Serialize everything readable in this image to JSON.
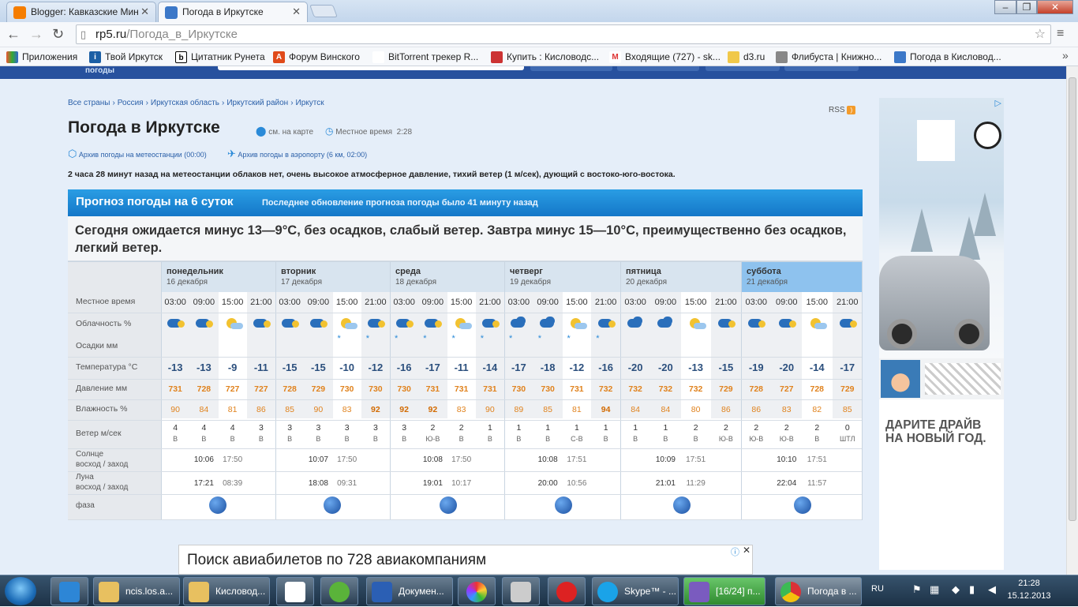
{
  "browser": {
    "tabs": [
      {
        "label": "Blogger: Кавказские Мин"
      },
      {
        "label": "Погода в Иркутске"
      }
    ],
    "url_host": "rp5.ru",
    "url_path": "/Погода_в_Иркутске",
    "bookmarks": [
      "Приложения",
      "Твой Иркутск",
      "Цитатник Рунета",
      "Форум Винского",
      "BitTorrent трекер R...",
      "Купить : Кисловодс...",
      "Входящие (727) - sk...",
      "d3.ru",
      "Флибуста | Книжно...",
      "Погода в Кисловод..."
    ]
  },
  "site": {
    "logo_text": "погоды"
  },
  "breadcrumb": [
    "Все страны",
    "Россия",
    "Иркутская область",
    "Иркутский район",
    "Иркутск"
  ],
  "page": {
    "title": "Погода в Иркутске",
    "map_link": "см. на карте",
    "local_time_label": "Местное время",
    "local_time": "2:28",
    "archive_station": "Архив погоды на метеостанции (00:00)",
    "archive_airport": "Архив погоды в аэропорту (6 км, 02:00)",
    "rss": "RSS",
    "observation": "2 часа 28 минут назад на метеостанции облаков нет, очень высокое атмосферное давление, тихий ветер (1 м/сек), дующий с востоко-юго-востока."
  },
  "forecast": {
    "header_title": "Прогноз погоды на 6 суток",
    "header_update": "Последнее обновление прогноза погоды было 41 минуту назад",
    "summary": "Сегодня ожидается минус 13—9°С, без осадков, слабый ветер. Завтра минус 15—10°С, преимущественно без осадков, легкий ветер.",
    "row_labels": {
      "time": "Местное время",
      "cloud": "Облачность %",
      "precip": "Осадки мм",
      "temp": "Температура °С",
      "pressure": "Давление мм",
      "humidity": "Влажность %",
      "wind": "Ветер м/сек",
      "sun": "Солнце",
      "sun_sub": "восход / заход",
      "moon": "Луна",
      "moon_sub": "восход / заход",
      "phase": "фаза"
    },
    "days": [
      {
        "name": "понедельник",
        "date": "16 декабря",
        "sunrise": "10:06",
        "sunset": "17:50",
        "moonrise": "17:21",
        "moonset": "08:39",
        "slots": [
          {
            "time": "03:00",
            "icon": "cloud-moon",
            "precip": "",
            "temp": "-13",
            "pres": "731",
            "hum": "90",
            "wind": "4",
            "dir": "В"
          },
          {
            "time": "09:00",
            "icon": "cloud-moon",
            "precip": "",
            "temp": "-13",
            "pres": "728",
            "hum": "84",
            "wind": "4",
            "dir": "В"
          },
          {
            "time": "15:00",
            "icon": "sun-cloud",
            "precip": "",
            "temp": "-9",
            "pres": "727",
            "hum": "81",
            "wind": "4",
            "dir": "В"
          },
          {
            "time": "21:00",
            "icon": "cloud-moon",
            "precip": "",
            "temp": "-11",
            "pres": "727",
            "hum": "86",
            "wind": "3",
            "dir": "В"
          }
        ]
      },
      {
        "name": "вторник",
        "date": "17 декабря",
        "sunrise": "10:07",
        "sunset": "17:50",
        "moonrise": "18:08",
        "moonset": "09:31",
        "slots": [
          {
            "time": "03:00",
            "icon": "cloud-moon",
            "precip": "",
            "temp": "-15",
            "pres": "728",
            "hum": "85",
            "wind": "3",
            "dir": "В"
          },
          {
            "time": "09:00",
            "icon": "cloud-moon",
            "precip": "",
            "temp": "-15",
            "pres": "729",
            "hum": "90",
            "wind": "3",
            "dir": "В"
          },
          {
            "time": "15:00",
            "icon": "sun-cloud",
            "precip": "*",
            "temp": "-10",
            "pres": "730",
            "hum": "83",
            "wind": "3",
            "dir": "В"
          },
          {
            "time": "21:00",
            "icon": "cloud-moon",
            "precip": "*",
            "temp": "-12",
            "pres": "730",
            "hum": "92",
            "wind": "3",
            "dir": "В"
          }
        ]
      },
      {
        "name": "среда",
        "date": "18 декабря",
        "sunrise": "10:08",
        "sunset": "17:50",
        "moonrise": "19:01",
        "moonset": "10:17",
        "slots": [
          {
            "time": "03:00",
            "icon": "cloud-moon",
            "precip": "*",
            "temp": "-16",
            "pres": "730",
            "hum": "92",
            "wind": "3",
            "dir": "В"
          },
          {
            "time": "09:00",
            "icon": "cloud-moon",
            "precip": "*",
            "temp": "-17",
            "pres": "731",
            "hum": "92",
            "wind": "2",
            "dir": "Ю-В"
          },
          {
            "time": "15:00",
            "icon": "sun-cloud",
            "precip": "*",
            "temp": "-11",
            "pres": "731",
            "hum": "83",
            "wind": "2",
            "dir": "В"
          },
          {
            "time": "21:00",
            "icon": "cloud-moon",
            "precip": "*",
            "temp": "-14",
            "pres": "731",
            "hum": "90",
            "wind": "1",
            "dir": "В"
          }
        ]
      },
      {
        "name": "четверг",
        "date": "19 декабря",
        "sunrise": "10:08",
        "sunset": "17:51",
        "moonrise": "20:00",
        "moonset": "10:56",
        "slots": [
          {
            "time": "03:00",
            "icon": "cloud",
            "precip": "*",
            "temp": "-17",
            "pres": "730",
            "hum": "89",
            "wind": "1",
            "dir": "В"
          },
          {
            "time": "09:00",
            "icon": "cloud",
            "precip": "*",
            "temp": "-18",
            "pres": "730",
            "hum": "85",
            "wind": "1",
            "dir": "В"
          },
          {
            "time": "15:00",
            "icon": "sun-cloud",
            "precip": "*",
            "temp": "-12",
            "pres": "731",
            "hum": "81",
            "wind": "1",
            "dir": "С-В"
          },
          {
            "time": "21:00",
            "icon": "cloud-moon",
            "precip": "*",
            "temp": "-16",
            "pres": "732",
            "hum": "94",
            "wind": "1",
            "dir": "В"
          }
        ]
      },
      {
        "name": "пятница",
        "date": "20 декабря",
        "sunrise": "10:09",
        "sunset": "17:51",
        "moonrise": "21:01",
        "moonset": "11:29",
        "slots": [
          {
            "time": "03:00",
            "icon": "cloud",
            "precip": "",
            "temp": "-20",
            "pres": "732",
            "hum": "84",
            "wind": "1",
            "dir": "В"
          },
          {
            "time": "09:00",
            "icon": "cloud",
            "precip": "",
            "temp": "-20",
            "pres": "732",
            "hum": "84",
            "wind": "1",
            "dir": "В"
          },
          {
            "time": "15:00",
            "icon": "sun-cloud",
            "precip": "",
            "temp": "-13",
            "pres": "732",
            "hum": "80",
            "wind": "2",
            "dir": "В"
          },
          {
            "time": "21:00",
            "icon": "cloud-moon",
            "precip": "",
            "temp": "-15",
            "pres": "729",
            "hum": "86",
            "wind": "2",
            "dir": "Ю-В"
          }
        ]
      },
      {
        "name": "суббота",
        "date": "21 декабря",
        "sunrise": "10:10",
        "sunset": "17:51",
        "moonrise": "22:04",
        "moonset": "11:57",
        "slots": [
          {
            "time": "03:00",
            "icon": "cloud-moon",
            "precip": "",
            "temp": "-19",
            "pres": "728",
            "hum": "86",
            "wind": "2",
            "dir": "Ю-В"
          },
          {
            "time": "09:00",
            "icon": "cloud-moon",
            "precip": "",
            "temp": "-20",
            "pres": "727",
            "hum": "83",
            "wind": "2",
            "dir": "Ю-В"
          },
          {
            "time": "15:00",
            "icon": "sun-cloud",
            "precip": "",
            "temp": "-14",
            "pres": "728",
            "hum": "82",
            "wind": "2",
            "dir": "В"
          },
          {
            "time": "21:00",
            "icon": "cloud-moon",
            "precip": "",
            "temp": "-17",
            "pres": "729",
            "hum": "85",
            "wind": "0",
            "dir": "ШТЛ"
          }
        ]
      }
    ]
  },
  "ad": {
    "text_line1": "ДАРИТЕ ДРАЙВ",
    "text_line2": "НА НОВЫЙ ГОД."
  },
  "flight_ad": {
    "text": "Поиск авиабилетов по 728 авиакомпаниям"
  },
  "taskbar": {
    "items": [
      "ncis.los.a...",
      "Кисловод...",
      "",
      "",
      "Докумен...",
      "",
      "",
      "",
      "Skype™ - ...",
      "[16/24] п...",
      "Погода в ..."
    ],
    "lang": "RU",
    "time": "21:28",
    "date": "15.12.2013"
  }
}
